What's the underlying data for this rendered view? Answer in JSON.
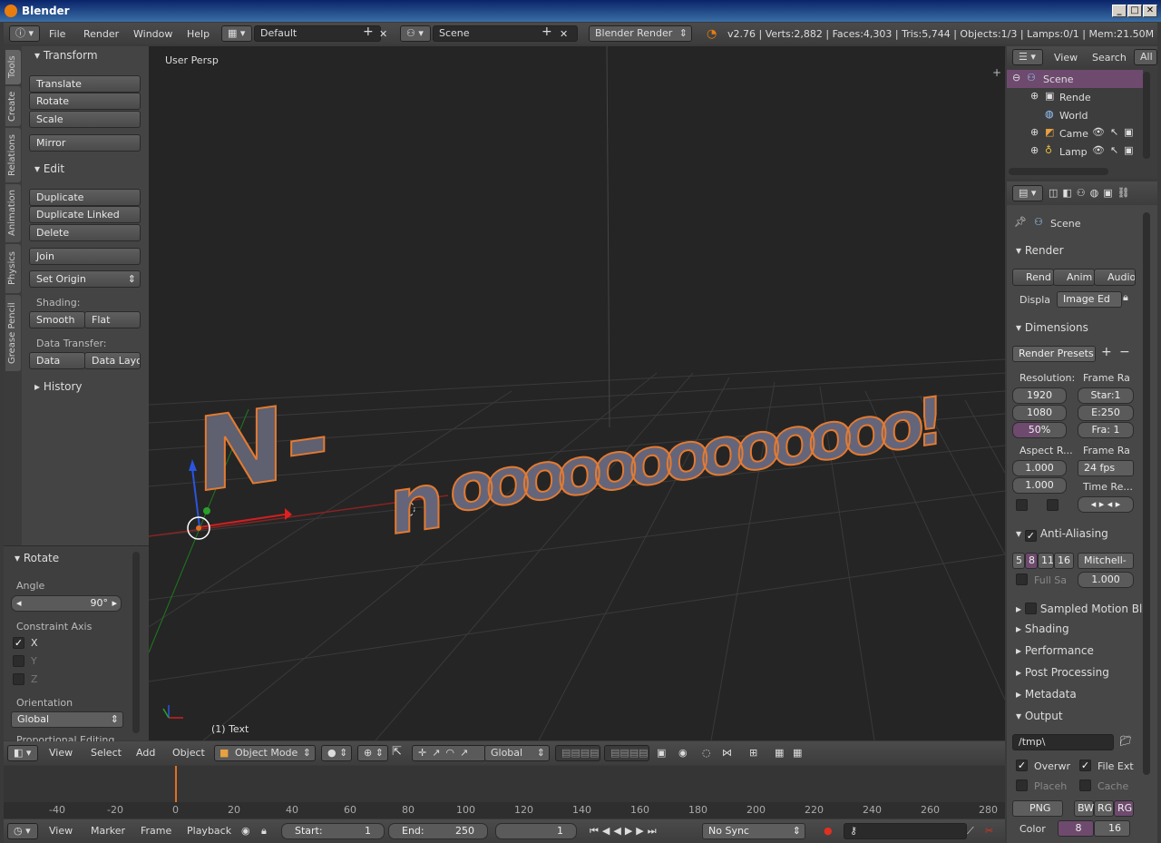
{
  "window": {
    "title": "Blender"
  },
  "infobar": {
    "menus": [
      "File",
      "Render",
      "Window",
      "Help"
    ],
    "layout": "Default",
    "scene": "Scene",
    "engine": "Blender Render",
    "stats": "v2.76 | Verts:2,882 | Faces:4,303 | Tris:5,744 | Objects:1/3 | Lamps:0/1 | Mem:21.50M (0.11M"
  },
  "tabs": [
    "Tools",
    "Create",
    "Relations",
    "Animation",
    "Physics",
    "Grease Pencil"
  ],
  "tools": {
    "transform_header": "Transform",
    "translate": "Translate",
    "rotate": "Rotate",
    "scale": "Scale",
    "mirror": "Mirror",
    "edit_header": "Edit",
    "duplicate": "Duplicate",
    "duplicate_linked": "Duplicate Linked",
    "delete": "Delete",
    "join": "Join",
    "set_origin": "Set Origin",
    "shading_label": "Shading:",
    "smooth": "Smooth",
    "flat": "Flat",
    "data_transfer_label": "Data Transfer:",
    "data": "Data",
    "data_layo": "Data Layo",
    "history_header": "History"
  },
  "operator": {
    "header": "Rotate",
    "angle_label": "Angle",
    "angle_value": "90°",
    "constraint_label": "Constraint Axis",
    "x": "X",
    "y": "Y",
    "z": "Z",
    "orientation_label": "Orientation",
    "orientation_value": "Global",
    "proportional_label": "Proportional Editing"
  },
  "viewport": {
    "view_label": "User Persp",
    "object_label": "(1) Text",
    "text3d": "N-nooooooooooooo!"
  },
  "vpheader": {
    "view": "View",
    "select": "Select",
    "add": "Add",
    "object": "Object",
    "mode": "Object Mode",
    "orientation": "Global"
  },
  "timeline": {
    "ticks": [
      "-40",
      "-20",
      "0",
      "20",
      "40",
      "60",
      "80",
      "100",
      "120",
      "140",
      "160",
      "180",
      "200",
      "220",
      "240",
      "260",
      "280"
    ],
    "current_frame_marker": 0
  },
  "tlheader": {
    "view": "View",
    "marker": "Marker",
    "frame": "Frame",
    "playback": "Playback",
    "start_label": "Start:",
    "start_value": "1",
    "end_label": "End:",
    "end_value": "250",
    "current": "1",
    "sync": "No Sync"
  },
  "outliner": {
    "view": "View",
    "search": "Search",
    "all": "All",
    "items": [
      "Scene",
      "Rende",
      "World",
      "Came",
      "Lamp"
    ]
  },
  "props": {
    "context": "Scene",
    "render_header": "Render",
    "rend": "Rend",
    "anim": "Anim",
    "audio": "Audio",
    "displa": "Displa",
    "image_ed": "Image Ed",
    "dimensions_header": "Dimensions",
    "render_presets": "Render Presets",
    "resolution_label": "Resolution:",
    "frame_ra_label": "Frame Ra",
    "res_x": "1920",
    "res_y": "1080",
    "res_pct": "50%",
    "star": "Star:1",
    "end": "E:250",
    "fra": "Fra: 1",
    "aspect_label": "Aspect R...",
    "frame_rate_label": "Frame Ra",
    "aspect_x": "1.000",
    "aspect_y": "1.000",
    "fps": "24 fps",
    "time_re_label": "Time Re...",
    "aa_header": "Anti-Aliasing",
    "aa_5": "5",
    "aa_8": "8",
    "aa_11": "11",
    "aa_16": "16",
    "filter": "Mitchell-",
    "full_sa": "Full Sa",
    "filter_size": "1.000",
    "motion_blur": "Sampled Motion Bl",
    "shading": "Shading",
    "performance": "Performance",
    "post_processing": "Post Processing",
    "metadata": "Metadata",
    "output_header": "Output",
    "path": "/tmp\\",
    "overwr": "Overwr",
    "file_ext": "File Ext",
    "placeh": "Placeh",
    "cache": "Cache",
    "format": "PNG",
    "bw": "BW",
    "rg": "RG",
    "rgb": "RG",
    "color_label": "Color",
    "color_8": "8",
    "color_16": "16"
  }
}
